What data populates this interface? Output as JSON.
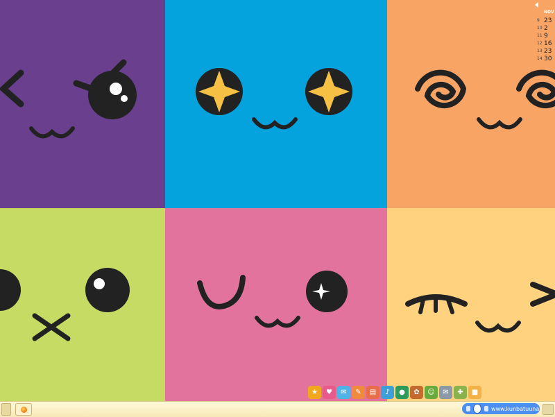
{
  "tiles": [
    {
      "id": "t1",
      "name": "purple-angry-face",
      "color": "#6a3f8e"
    },
    {
      "id": "t2",
      "name": "blue-sparkle-eyes-face",
      "color": "#05a3dd"
    },
    {
      "id": "t3",
      "name": "orange-dizzy-face",
      "color": "#f8a465"
    },
    {
      "id": "t4",
      "name": "green-surprised-face",
      "color": "#c5db63"
    },
    {
      "id": "t5",
      "name": "pink-winking-face",
      "color": "#e2739c"
    },
    {
      "id": "t6",
      "name": "yellow-sleepy-face",
      "color": "#fed27f"
    }
  ],
  "calendar": {
    "month": "NOV",
    "rows": [
      {
        "week": "9",
        "day": "23"
      },
      {
        "week": "10",
        "day": "2"
      },
      {
        "week": "11",
        "day": "9"
      },
      {
        "week": "12",
        "day": "16"
      },
      {
        "week": "13",
        "day": "23"
      },
      {
        "week": "14",
        "day": "30"
      }
    ]
  },
  "tray_icons": [
    {
      "name": "star-icon",
      "glyph": "★",
      "color": "#f2a81d"
    },
    {
      "name": "heart-icon",
      "glyph": "♥",
      "color": "#e85a8a"
    },
    {
      "name": "chat-icon",
      "glyph": "✉",
      "color": "#4fb3e8"
    },
    {
      "name": "pencil-icon",
      "glyph": "✎",
      "color": "#f08a3c"
    },
    {
      "name": "notebook-icon",
      "glyph": "▤",
      "color": "#e96d48"
    },
    {
      "name": "music-icon",
      "glyph": "♪",
      "color": "#3f9fd8"
    },
    {
      "name": "globe-icon",
      "glyph": "●",
      "color": "#2e9a5b"
    },
    {
      "name": "bear-icon",
      "glyph": "✿",
      "color": "#c46b2d"
    },
    {
      "name": "friends-icon",
      "glyph": "☺",
      "color": "#6aaa3c"
    },
    {
      "name": "mail-icon",
      "glyph": "✉",
      "color": "#8c9aa8"
    },
    {
      "name": "puzzle-icon",
      "glyph": "✚",
      "color": "#8ab34d"
    },
    {
      "name": "box-icon",
      "glyph": "■",
      "color": "#f3b246"
    }
  ],
  "media_player": {
    "track": "www.kunbatuuna.com"
  }
}
